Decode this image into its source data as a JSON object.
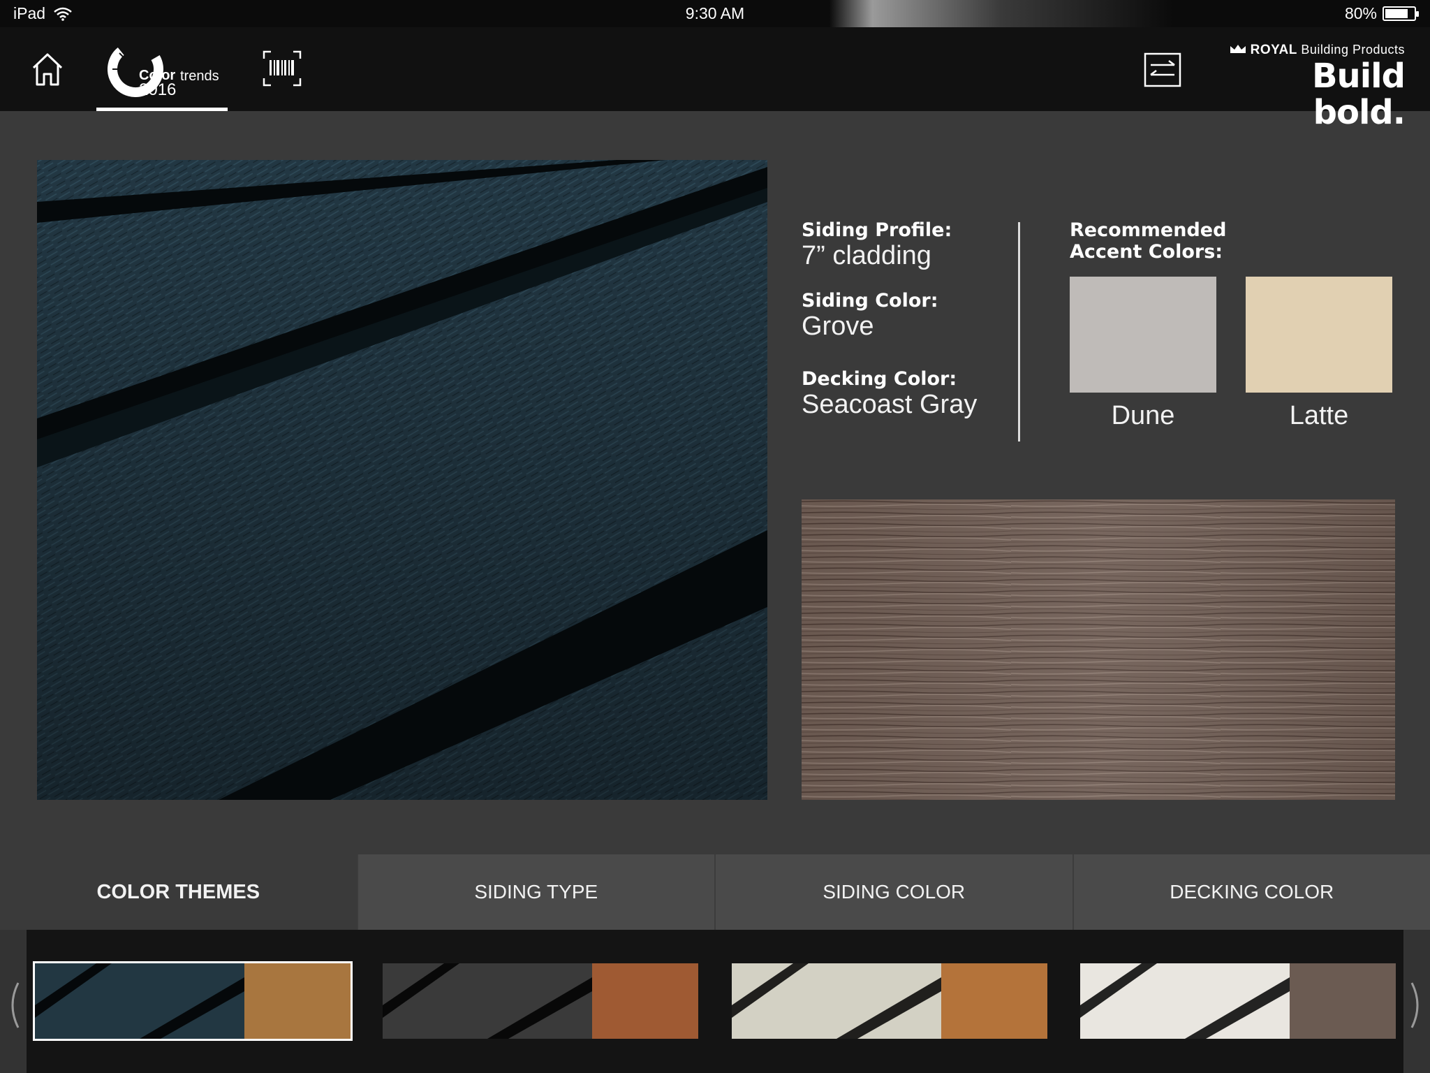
{
  "status": {
    "device": "iPad",
    "time": "9:30 AM",
    "battery": "80%",
    "battery_level": 0.8
  },
  "nav": {
    "color_trends": {
      "word1": "Color",
      "word2": "trends",
      "year": "2016"
    },
    "brand": {
      "company": "ROYAL",
      "company_suffix": "Building Products",
      "tagline": "Build bold."
    }
  },
  "details": {
    "profile_label": "Siding Profile:",
    "profile_value": "7” cladding",
    "siding_color_label": "Siding Color:",
    "siding_color_value": "Grove",
    "decking_color_label": "Decking Color:",
    "decking_color_value": "Seacoast Gray",
    "accent_title_line1": "Recommended",
    "accent_title_line2": "Accent Colors:",
    "accents": [
      {
        "name": "Dune",
        "color": "#bfbbb8"
      },
      {
        "name": "Latte",
        "color": "#e1d0b2"
      }
    ]
  },
  "tabs": [
    {
      "label": "COLOR THEMES",
      "active": true
    },
    {
      "label": "SIDING TYPE",
      "active": false
    },
    {
      "label": "SIDING COLOR",
      "active": false
    },
    {
      "label": "DECKING COLOR",
      "active": false
    }
  ],
  "themes": [
    {
      "siding": "#223742",
      "deck": "#a8763f",
      "selected": true
    },
    {
      "siding": "#3a3a3a",
      "deck": "#9f5a33",
      "selected": false
    },
    {
      "siding": "#d3d1c4",
      "deck": "#b4733a",
      "selected": false
    },
    {
      "siding": "#e9e6e0",
      "deck": "#6b5b52",
      "selected": false
    }
  ],
  "colors": {
    "siding_main": "#213641",
    "decking_main": "#6e5c53"
  }
}
